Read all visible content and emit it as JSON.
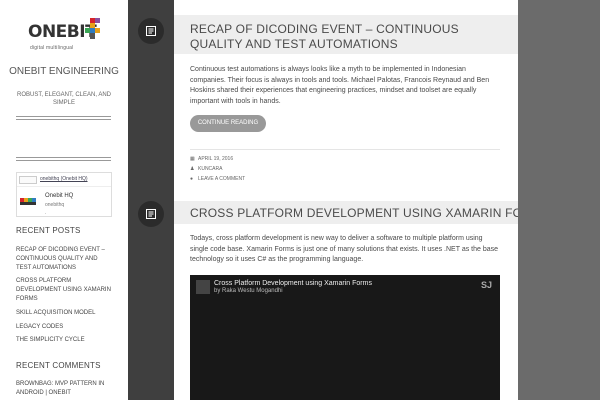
{
  "sidebar": {
    "logo_text": "ONEBIT",
    "logo_tagline": "digital multilingual",
    "site_title": "ONEBIT ENGINEERING",
    "site_description": "ROBUST, ELEGANT, CLEAN, AND SIMPLE",
    "twitter": {
      "header_link": "onebithq (Onebit HQ)",
      "name": "Onebit HQ",
      "handle": "onebithq",
      "trailing": "."
    },
    "recent_posts_title": "RECENT POSTS",
    "recent_posts": [
      "RECAP OF DICODING EVENT – CONTINUOUS QUALITY AND TEST AUTOMATIONS",
      "CROSS PLATFORM DEVELOPMENT USING XAMARIN FORMS",
      "SKILL ACQUISITION MODEL",
      "LEGACY CODES",
      "THE SIMPLICITY CYCLE"
    ],
    "recent_comments_title": "RECENT COMMENTS",
    "recent_comments": [
      "BROWNBAG: MVP PATTERN IN ANDROID | ONEBIT"
    ]
  },
  "posts": [
    {
      "title": "RECAP OF DICODING EVENT – CONTINUOUS QUALITY AND TEST AUTOMATIONS",
      "excerpt": "Continuous test automations is always looks like a myth to be implemented in Indonesian companies. Their focus is always in tools and tools. Michael Palotas, Francois Reynaud and Ben Hoskins shared their experiences that engineering practices, mindset and toolset are equally important with tools in hands.",
      "button": "CONTINUE READING",
      "date": "APRIL 19, 2016",
      "author": "KUNCARA",
      "comment": "LEAVE A COMMENT"
    },
    {
      "title": "CROSS PLATFORM DEVELOPMENT USING XAMARIN FORMS",
      "excerpt": "Todays, cross platform development is new way to deliver a software to multiple platform using single code base. Xamarin Forms is just one of many solutions that exists. It uses .NET as the base technology so it uses C# as the programming language.",
      "video_title": "Cross Platform Development using Xamarin Forms",
      "video_by": "by Raka Westu Mogandhi",
      "video_logo": "SJ"
    }
  ],
  "colors": {
    "background": "#6b6b6b",
    "band": "#3f3f3f",
    "title_bar": "#eeeeee",
    "button": "#999999"
  }
}
